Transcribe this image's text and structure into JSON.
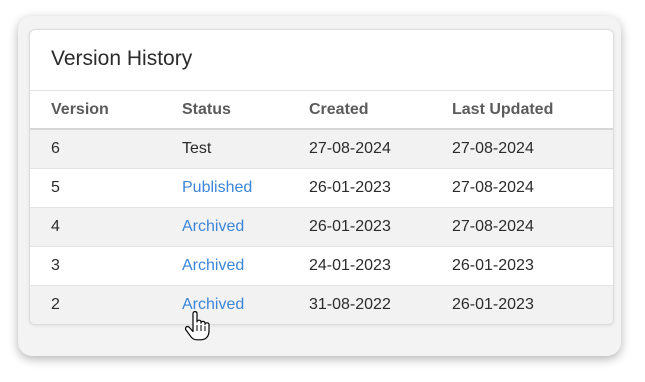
{
  "panel": {
    "title": "Version History"
  },
  "columns": [
    "Version",
    "Status",
    "Created",
    "Last Updated"
  ],
  "rows": [
    {
      "version": "6",
      "status": "Test",
      "created": "27-08-2024",
      "updated": "27-08-2024"
    },
    {
      "version": "5",
      "status": "Published",
      "created": "26-01-2023",
      "updated": "27-08-2024"
    },
    {
      "version": "4",
      "status": "Archived",
      "created": "26-01-2023",
      "updated": "27-08-2024"
    },
    {
      "version": "3",
      "status": "Archived",
      "created": "24-01-2023",
      "updated": "26-01-2023"
    },
    {
      "version": "2",
      "status": "Archived",
      "created": "31-08-2022",
      "updated": "26-01-2023"
    }
  ],
  "colors": {
    "link": "#3a86d8",
    "stripe": "#f2f2f2",
    "text": "#2b2b2b",
    "header_text": "#5b5b5b"
  },
  "cursor_icon": "hand-pointer-icon"
}
